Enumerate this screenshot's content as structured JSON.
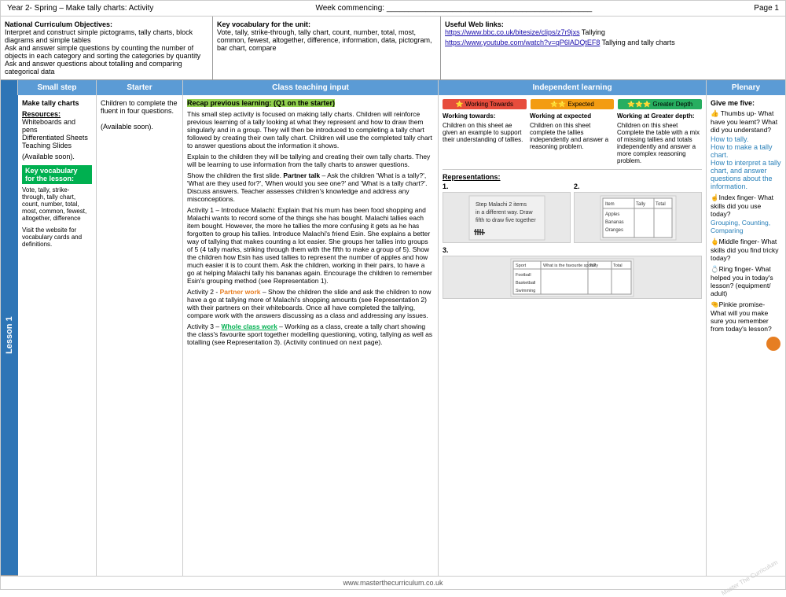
{
  "header": {
    "title": "Year 2- Spring – Make tally charts: Activity",
    "week": "Week commencing: _______________________________________________",
    "page": "Page 1"
  },
  "objectives": {
    "title": "National Curriculum Objectives:",
    "items": [
      "Interpret and construct simple pictograms, tally charts, block diagrams and simple tables",
      "Ask and answer simple questions by counting the number of objects in each category and sorting the categories by quantity",
      "Ask and answer questions about totalling and comparing categorical data"
    ]
  },
  "vocab": {
    "title": "Key vocabulary for the unit:",
    "text": "Vote, tally, strike-through, tally chart, count, number, total, most, common, fewest, altogether, difference, information, data, pictogram, bar chart, compare"
  },
  "weblinks": {
    "title": "Useful Web links:",
    "links": [
      {
        "url": "https://www.bbc.co.uk/bitesize/clips/z7r9jxs",
        "label": "https://www.bbc.co.uk/bitesize/clips/z7r9jxs",
        "suffix": " Tallying"
      },
      {
        "url": "https://www.youtube.com/watch?v=qP6lADQtEF8",
        "label": "https://www.youtube.com/watch?v=qP6lADQtEF8",
        "suffix": " Tallying and tally charts"
      }
    ]
  },
  "table": {
    "headers": {
      "small_step": "Small step",
      "starter": "Starter",
      "teaching": "Class teaching input",
      "independent": "Independent learning",
      "plenary": "Plenary"
    },
    "lesson": "Lesson 1",
    "small_step": {
      "title": "Make tally charts",
      "resources_label": "Resources:",
      "resources": "Whiteboards and pens\nDifferentiated Sheets\nTeaching Slides",
      "available": "(Available soon).",
      "key_vocab_label": "Key vocabulary for the lesson:",
      "key_vocab": "Vote, tally, strike-through, tally chart, count, number, total, most, common, fewest, altogether, difference",
      "visit": "Visit the website for vocabulary cards and definitions."
    },
    "starter": {
      "text": "Children to complete the fluent in four questions.",
      "available": "(Available soon)."
    },
    "teaching": {
      "recap": "Recap previous learning: (Q1 on the starter)",
      "para1": "This small step activity is focused on making tally charts. Children will reinforce previous learning of a tally looking at what they represent and how to draw them singularly and in a group. They will then be introduced to completing a tally chart followed by creating their own tally chart. Children will use the completed tally chart to answer questions about the information it shows.",
      "para2": "Explain to the children they will be tallying and creating their own tally charts. They will be learning to use information from the tally charts to answer questions.",
      "para3_start": "Show the children the first slide. ",
      "partner_talk": "Partner talk",
      "para3_end": " – Ask the children 'What is a tally?', 'What are they used for?', 'When would you see one?' and 'What is a tally chart?'. Discuss answers. Teacher assesses children's knowledge and address any misconceptions.",
      "para4": "Activity 1 – Introduce Malachi: Explain that his mum has been food shopping and Malachi wants to record some of the things she has bought. Malachi tallies each item bought. However, the more he tallies the more confusing it gets as he has forgotten to group his tallies. Introduce Malachi's friend Esin. She explains a better way of tallying that makes counting a lot easier. She groups her tallies into groups of 5 (4 tally marks, striking through them with the fifth to make a group of 5). Show the children how Esin has used tallies to represent the number of apples and how much easier it is to count them. Ask the children, working in their pairs, to have a go at helping Malachi tally his bananas again. Encourage the children to remember Esin's grouping method (see Representation 1).",
      "para5_start": "Activity 2 - ",
      "partner_work": "Partner work",
      "para5_end": " – Show the children the slide and ask the children to now have a go at tallying more of Malachi's shopping amounts (see Representation 2) with their partners on their whiteboards. Once all have completed the tallying, compare work with the answers discussing as a class and addressing any issues.",
      "para6_start": "Activity 3 – ",
      "whole_class": "Whole class work",
      "para6_end": " – Working as a class, create a tally chart showing the class's favourite sport together modelling questioning, voting, tallying as well as totalling (see Representation 3). (Activity continued on next page)."
    },
    "independent": {
      "sub_headers": {
        "wt": "Working Towards",
        "exp": "Expected",
        "gd": "Greater Depth"
      },
      "wt_star": "⭐",
      "exp_stars": "⭐⭐",
      "gd_stars": "⭐⭐⭐",
      "wt_title": "Working towards:",
      "exp_title": "Working at expected",
      "gd_title": "Working at Greater depth:",
      "wt_text": "Children on this sheet ae given an example to support their understanding of tallies.",
      "exp_text": "Children on this sheet complete the tallies independently and answer a reasoning problem.",
      "gd_text": "Children on this sheet Complete the table with a mix of missing tallies and totals independently and answer a more complex reasoning problem.",
      "representations": "Representations:",
      "rep1_label": "1.",
      "rep2_label": "2.",
      "rep3_label": "3."
    },
    "plenary": {
      "give_five": "Give me five:",
      "thumbs": "👍 Thumbs up- What have you learnt? What did you understand?",
      "how_to_tally": "How to tally.",
      "how_to_make": "How to make a tally chart.",
      "how_to_interpret": "How to interpret a tally chart, and answer questions about the information.",
      "index": "☝️Index finger- What skills did you use today?",
      "index_skills": "Grouping, Counting, Comparing",
      "middle": "🖕Middle finger- What skills did you find tricky today?",
      "ring": "💍Ring finger- What helped you in today's lesson? (equipment/ adult)",
      "pinkie": "🤏Pinkie promise- What will you make sure you remember from today's lesson?"
    }
  },
  "footer": {
    "text": "www.masterthecurriculum.co.uk"
  }
}
